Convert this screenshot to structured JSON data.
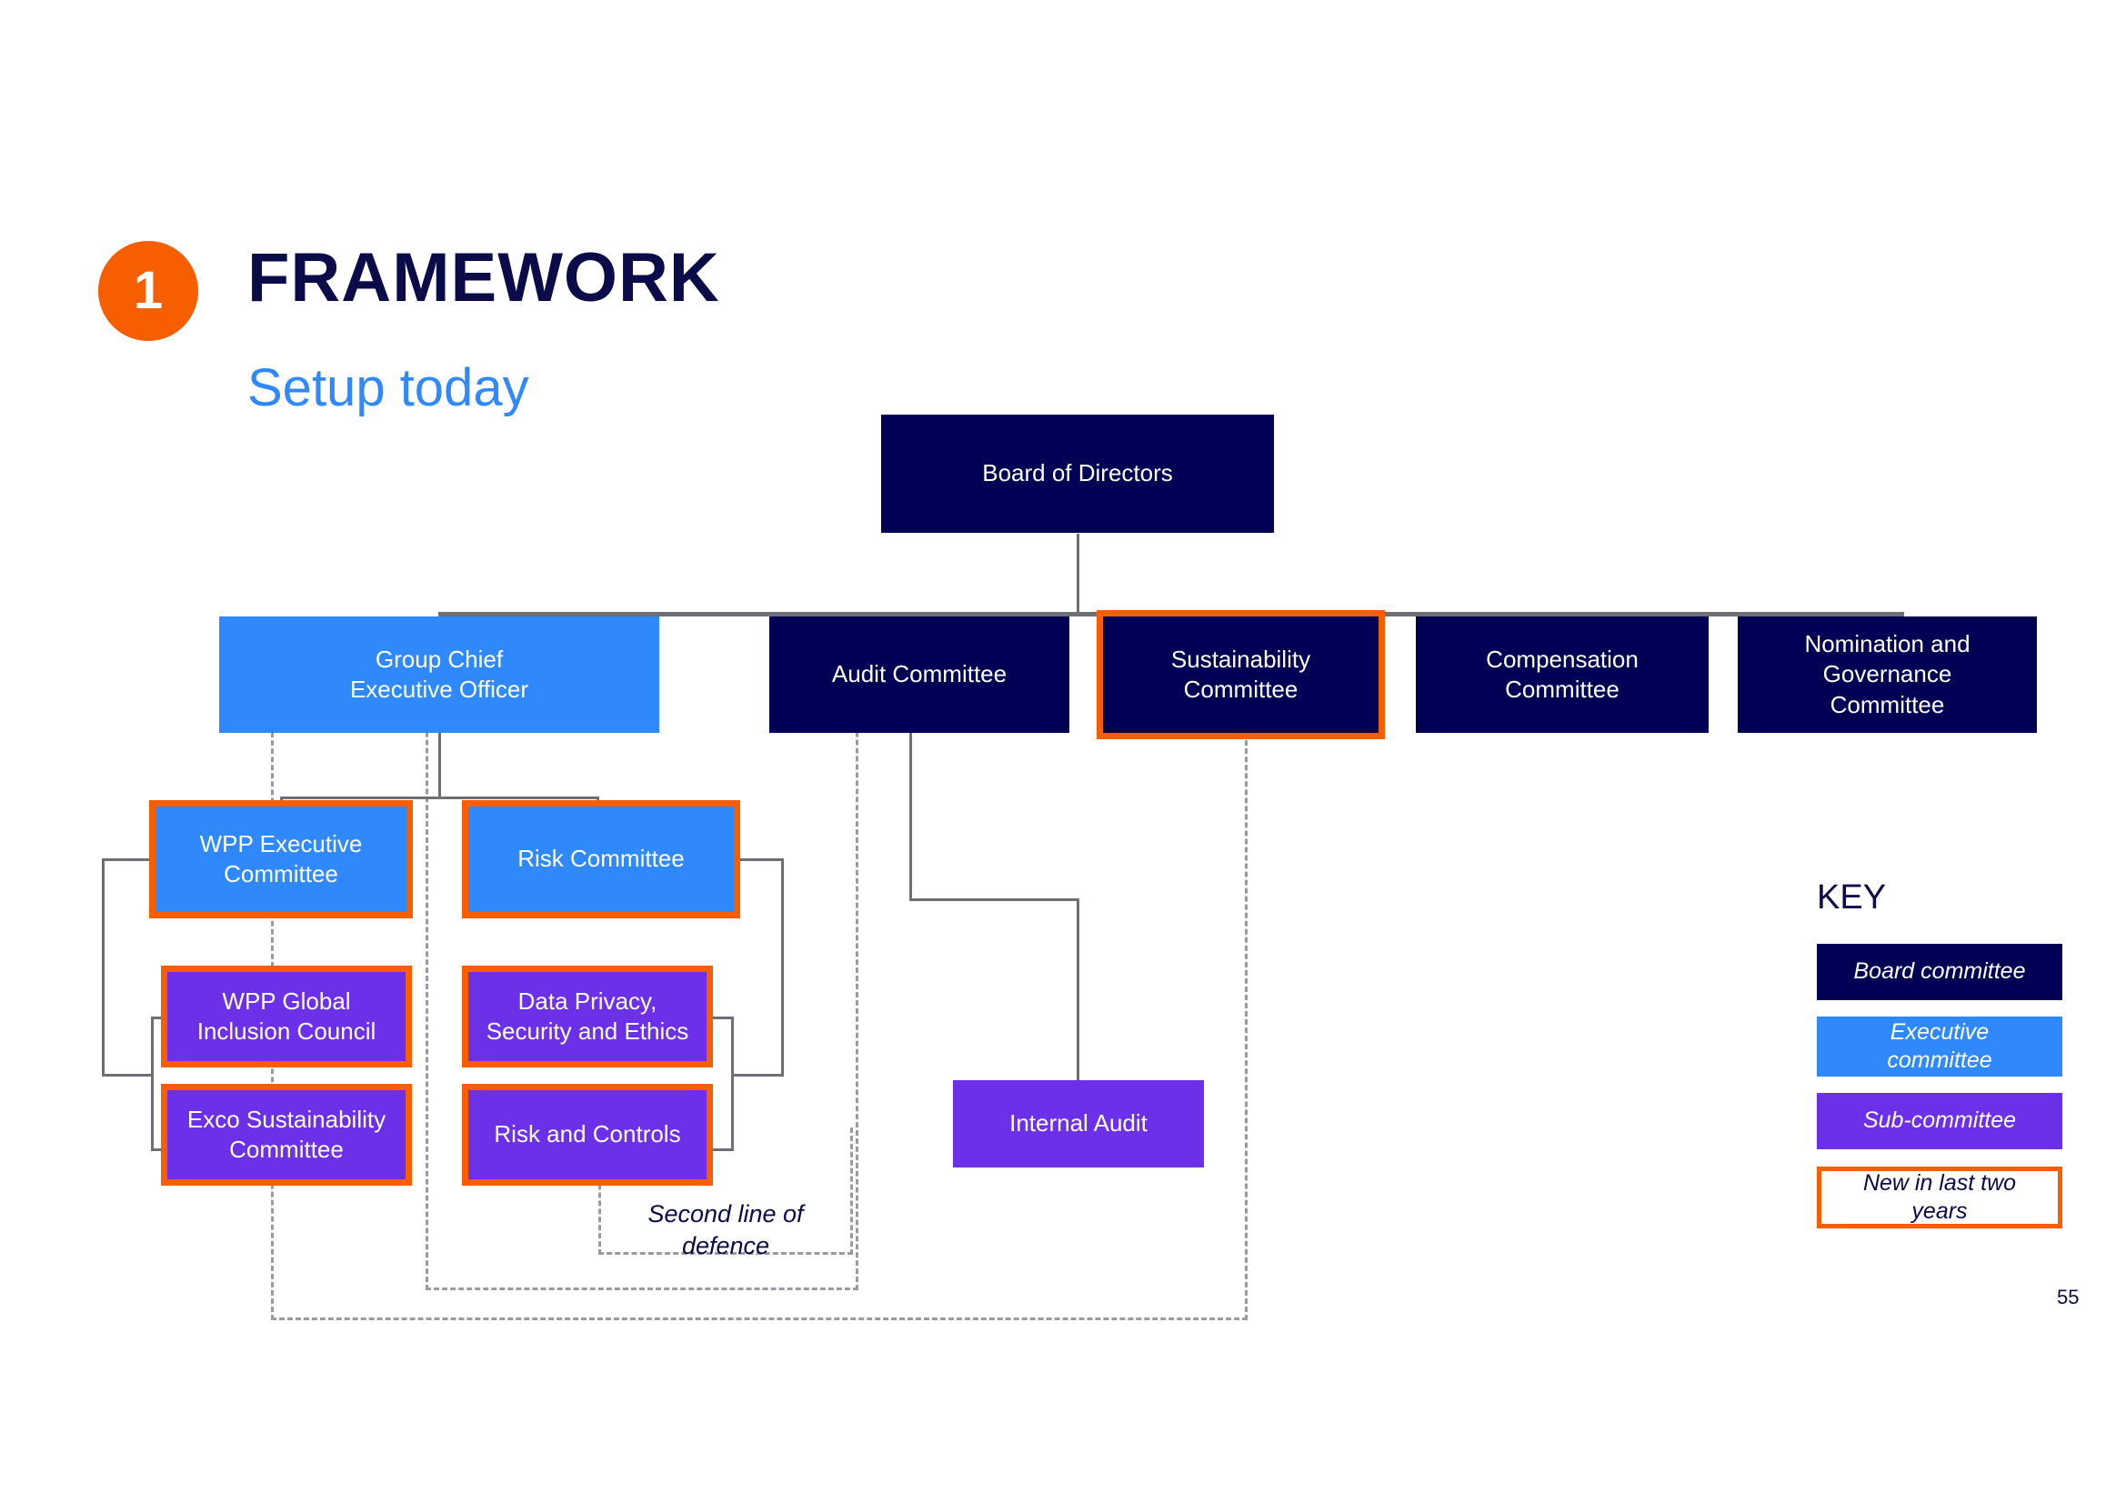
{
  "header": {
    "badge_number": "1",
    "title": "FRAMEWORK",
    "subtitle": "Setup today"
  },
  "colors": {
    "board": "#000054",
    "executive": "#3089FB",
    "sub_committee": "#6B30E8",
    "new_accent": "#F75E00",
    "connector": "#6E6E76",
    "dashed_boundary": "#9A9AA4",
    "title": "#0B0B4A"
  },
  "chart_data": {
    "type": "diagram",
    "title": "Setup today",
    "nodes": [
      {
        "id": "board",
        "label": "Board of Directors",
        "category": "board",
        "is_new": false
      },
      {
        "id": "ceo",
        "label": "Group Chief\nExecutive Officer",
        "category": "executive",
        "is_new": false
      },
      {
        "id": "audit",
        "label": "Audit Committee",
        "category": "board",
        "is_new": false
      },
      {
        "id": "sustainability",
        "label": "Sustainability\nCommittee",
        "category": "board",
        "is_new": true
      },
      {
        "id": "compensation",
        "label": "Compensation\nCommittee",
        "category": "board",
        "is_new": false
      },
      {
        "id": "nomination",
        "label": "Nomination and\nGovernance\nCommittee",
        "category": "board",
        "is_new": false
      },
      {
        "id": "wpp_exec",
        "label": "WPP Executive\nCommittee",
        "category": "executive",
        "is_new": true
      },
      {
        "id": "risk_committee",
        "label": "Risk Committee",
        "category": "executive",
        "is_new": true
      },
      {
        "id": "inclusion",
        "label": "WPP Global\nInclusion Council",
        "category": "sub_committee",
        "is_new": true
      },
      {
        "id": "data_privacy",
        "label": "Data Privacy,\nSecurity and Ethics",
        "category": "sub_committee",
        "is_new": true
      },
      {
        "id": "exco_sust",
        "label": "Exco Sustainability\nCommittee",
        "category": "sub_committee",
        "is_new": true
      },
      {
        "id": "risk_controls",
        "label": "Risk and Controls",
        "category": "sub_committee",
        "is_new": true
      },
      {
        "id": "internal_audit",
        "label": "Internal Audit",
        "category": "sub_committee",
        "is_new": false
      }
    ],
    "edges": [
      {
        "from": "board",
        "to": "ceo"
      },
      {
        "from": "board",
        "to": "audit"
      },
      {
        "from": "board",
        "to": "sustainability"
      },
      {
        "from": "board",
        "to": "compensation"
      },
      {
        "from": "board",
        "to": "nomination"
      },
      {
        "from": "ceo",
        "to": "wpp_exec"
      },
      {
        "from": "ceo",
        "to": "risk_committee"
      },
      {
        "from": "wpp_exec",
        "to": "inclusion"
      },
      {
        "from": "wpp_exec",
        "to": "exco_sust"
      },
      {
        "from": "risk_committee",
        "to": "data_privacy"
      },
      {
        "from": "risk_committee",
        "to": "risk_controls"
      },
      {
        "from": "audit",
        "to": "internal_audit"
      }
    ],
    "annotations": [
      {
        "id": "second_line",
        "label": "Second line of\ndefence"
      }
    ]
  },
  "nodes": {
    "board_of_directors": "Board of Directors",
    "ceo_line1": "Group Chief",
    "ceo_line2": "Executive Officer",
    "audit_committee": "Audit Committee",
    "sustainability_line1": "Sustainability",
    "sustainability_line2": "Committee",
    "compensation_line1": "Compensation",
    "compensation_line2": "Committee",
    "nomination_line1": "Nomination and",
    "nomination_line2": "Governance",
    "nomination_line3": "Committee",
    "wpp_exec_line1": "WPP Executive",
    "wpp_exec_line2": "Committee",
    "risk_committee": "Risk Committee",
    "inclusion_line1": "WPP Global",
    "inclusion_line2": "Inclusion Council",
    "data_privacy_line1": "Data Privacy,",
    "data_privacy_line2": "Security and Ethics",
    "exco_sust_line1": "Exco Sustainability",
    "exco_sust_line2": "Committee",
    "risk_controls": "Risk and Controls",
    "internal_audit": "Internal Audit"
  },
  "annotations": {
    "second_line_of_defence_line1": "Second line of",
    "second_line_of_defence_line2": "defence"
  },
  "key": {
    "title": "KEY",
    "items": [
      {
        "label_italic": "Board",
        "label_rest": " committee",
        "category": "board"
      },
      {
        "label_line1": "Executive",
        "label_line2": "committee",
        "category": "executive"
      },
      {
        "label_line1": "Sub-committee",
        "category": "sub_committee"
      },
      {
        "label_line1": "New in last two",
        "label_line2": "years",
        "category": "new"
      }
    ]
  },
  "footer": {
    "page_number": "55"
  }
}
